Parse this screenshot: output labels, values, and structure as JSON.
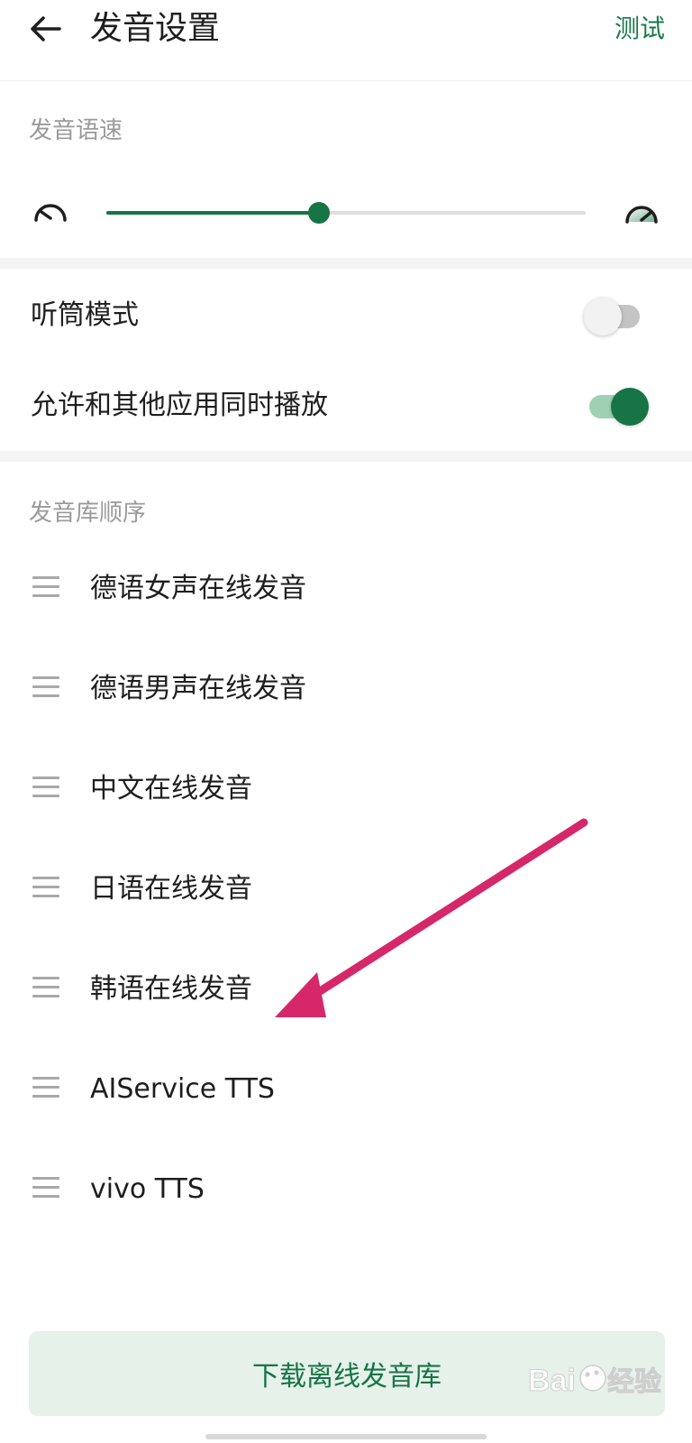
{
  "header": {
    "back_icon": "arrow-left-icon",
    "title": "发音设置",
    "test_label": "测试"
  },
  "speed": {
    "section_label": "发音语速",
    "slow_icon": "speed-slow-icon",
    "fast_icon": "speed-fast-icon",
    "value_fraction": 0.443
  },
  "toggles": [
    {
      "label": "听筒模式",
      "on": false
    },
    {
      "label": "允许和其他应用同时播放",
      "on": true
    }
  ],
  "order": {
    "section_label": "发音库顺序",
    "items": [
      {
        "label": "德语女声在线发音"
      },
      {
        "label": "德语男声在线发音"
      },
      {
        "label": "中文在线发音"
      },
      {
        "label": "日语在线发音"
      },
      {
        "label": "韩语在线发音"
      },
      {
        "label": "AIService TTS"
      },
      {
        "label": "vivo TTS"
      }
    ]
  },
  "download_button": {
    "label": "下载离线发音库"
  },
  "colors": {
    "accent": "#167445",
    "annotation_arrow": "#d6276a"
  },
  "watermark": {
    "text": "Baidu经验"
  }
}
